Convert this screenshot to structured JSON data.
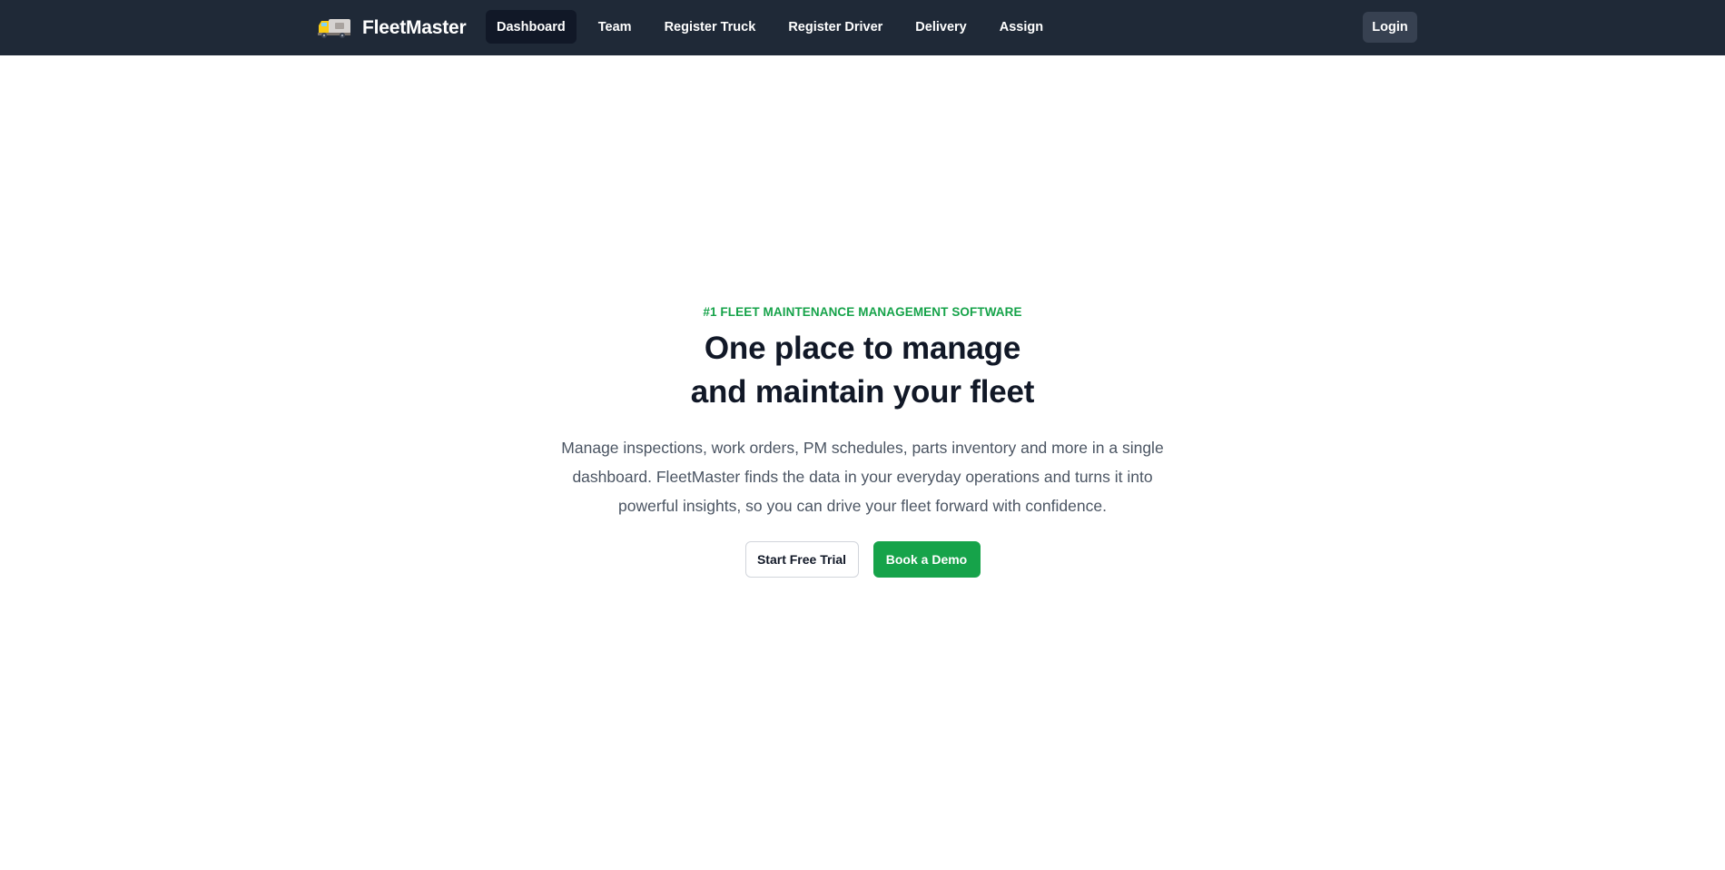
{
  "nav": {
    "brand": {
      "name": "FleetMaster",
      "icon": "truck-icon"
    },
    "items": [
      {
        "label": "Dashboard",
        "active": true
      },
      {
        "label": "Team",
        "active": false
      },
      {
        "label": "Register Truck",
        "active": false
      },
      {
        "label": "Register Driver",
        "active": false
      },
      {
        "label": "Delivery",
        "active": false
      },
      {
        "label": "Assign",
        "active": false
      }
    ],
    "login_label": "Login"
  },
  "hero": {
    "eyebrow": "#1 FLEET MAINTENANCE MANAGEMENT SOFTWARE",
    "headline_line1": "One place to manage",
    "headline_line2": "and maintain your fleet",
    "description": "Manage inspections, work orders, PM schedules, parts inventory and more in a single dashboard. FleetMaster finds the data in your everyday operations and turns it into powerful insights, so you can drive your fleet forward with confidence.",
    "primary_cta": "Book a Demo",
    "secondary_cta": "Start Free Trial"
  },
  "colors": {
    "nav_bg": "#1f2937",
    "nav_active_bg": "#111827",
    "accent_green": "#16a34a",
    "headline": "#111827",
    "body_text": "#4b5563"
  }
}
